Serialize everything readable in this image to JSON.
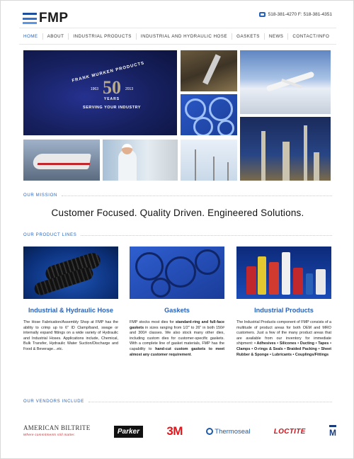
{
  "header": {
    "logo_text": "FMP",
    "contact": "518-381-4270 F: 518-381-4351"
  },
  "nav": {
    "items": [
      "HOME",
      "ABOUT",
      "INDUSTRIAL PRODUCTS",
      "INDUSTRIAL AND HYDRAULIC HOSE",
      "GASKETS",
      "NEWS",
      "CONTACT/INFO"
    ],
    "active": "HOME"
  },
  "hero": {
    "arc_text": "FRANK MURKEN PRODUCTS",
    "year_start": "1963",
    "big_number": "50",
    "years_word": "YEARS",
    "year_end": "2013",
    "tagline": "SERVING YOUR INDUSTRY"
  },
  "mission": {
    "label": "OUR MISSION",
    "statement": "Customer Focused. Quality Driven. Engineered Solutions."
  },
  "product_lines": {
    "label": "OUR PRODUCT LINES",
    "items": [
      {
        "title": "Industrial & Hydraulic Hose",
        "text": "The Hose Fabrication/Assembly Shop at FMP has the ability to crimp up to 6\" ID Clamp/band, swage or internally expand fittings on a wide variety of Hydraulic and Industrial Hoses. Applications include, Chemical, Bulk Transfer, Hydraulic Water Suction/Discharge and Food & Beverage…etc."
      },
      {
        "title": "Gaskets",
        "text_a": "FMP stocks most dies for ",
        "text_b": "standard-ring and full-face gaskets",
        "text_c": " in sizes ranging from 1/2\" to 26\" in both 150# and 300# classes. We also stock many other dies, including custom dies for customer-specific gaskets. With a complete line of gasket materials, FMP has the capability to ",
        "text_d": "hand-cut custom gaskets to meet almost any customer requirement",
        "text_e": "."
      },
      {
        "title": "Industrial Products",
        "text_a": "The Industrial Products component of FMP consists of a multitude of product areas for both OEM and MRO customers. Just a few of the many product areas that are available from our inventory for immediate shipment: ",
        "text_b": "• Adhesives • Silicones • Ducting • Tapes • Clamps • O-rings & Seals • Braided Packing • Sheet Rubber & Sponge • Lubricants • Couplings/Fittings"
      }
    ]
  },
  "vendors": {
    "label": "OUR VENDORS INCLUDE",
    "american_biltrite": "AMERICAN BILTRITE",
    "american_biltrite_tagline": "Where commitments still matter.",
    "parker": "Parker",
    "three_m": "3M",
    "thermoseal": "Thermoseal",
    "loctite": "LOCTITE",
    "m_logo": "M"
  },
  "colors": {
    "accent": "#2a62b8",
    "brand_dark": "#1f4e9c"
  }
}
